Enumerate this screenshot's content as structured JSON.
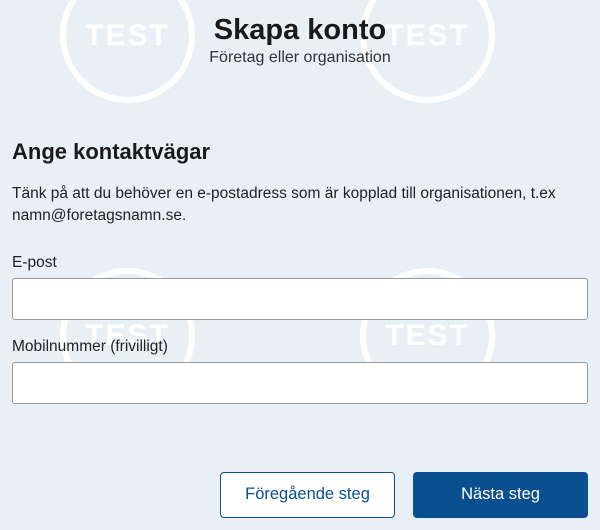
{
  "watermark_text": "TEST",
  "header": {
    "title": "Skapa konto",
    "subtitle": "Företag eller organisation"
  },
  "section": {
    "heading": "Ange kontaktvägar",
    "help_text": "Tänk på att du behöver en e-postadress som är kopplad till organisationen, t.ex namn@foretagsnamn.se."
  },
  "fields": {
    "email": {
      "label": "E-post",
      "value": ""
    },
    "mobile": {
      "label": "Mobilnummer (frivilligt)",
      "value": ""
    }
  },
  "buttons": {
    "prev": "Föregående steg",
    "next": "Nästa steg"
  }
}
